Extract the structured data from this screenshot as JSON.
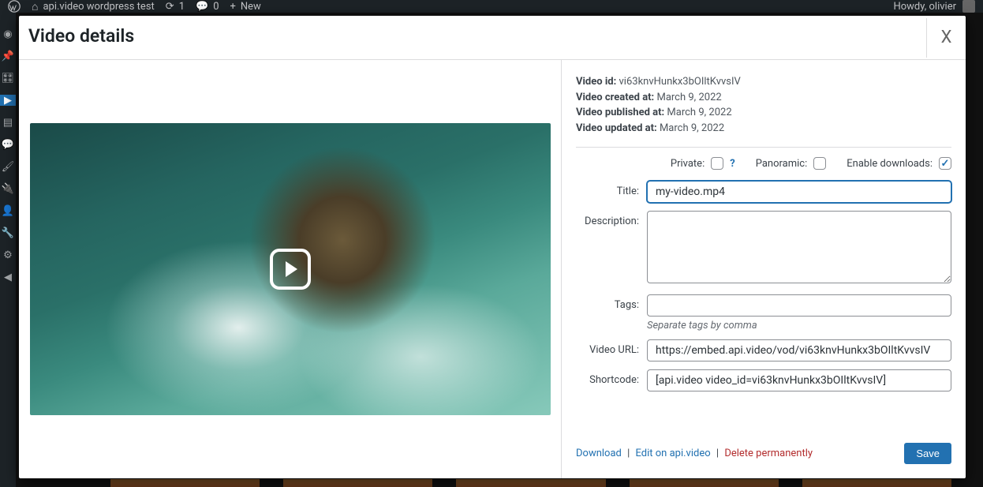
{
  "adminbar": {
    "site_title": "api.video wordpress test",
    "updates_count": "1",
    "comments_count": "0",
    "new_label": "New",
    "howdy": "Howdy, olivier"
  },
  "modal": {
    "title": "Video details",
    "close": "X"
  },
  "meta": {
    "video_id_label": "Video id:",
    "video_id": "vi63knvHunkx3bOIltKvvsIV",
    "created_label": "Video created at:",
    "created": "March 9, 2022",
    "published_label": "Video published at:",
    "published": "March 9, 2022",
    "updated_label": "Video updated at:",
    "updated": "March 9, 2022"
  },
  "checks": {
    "private_label": "Private:",
    "private_checked": false,
    "help": "?",
    "panoramic_label": "Panoramic:",
    "panoramic_checked": false,
    "downloads_label": "Enable downloads:",
    "downloads_checked": true
  },
  "form": {
    "title_label": "Title:",
    "title_value": "my-video.mp4",
    "description_label": "Description:",
    "description_value": "",
    "tags_label": "Tags:",
    "tags_value": "",
    "tags_hint": "Separate tags by comma",
    "video_url_label": "Video URL:",
    "video_url_value": "https://embed.api.video/vod/vi63knvHunkx3bOIltKvvsIV",
    "shortcode_label": "Shortcode:",
    "shortcode_value": "[api.video video_id=vi63knvHunkx3bOIltKvvsIV]"
  },
  "footer": {
    "download": "Download",
    "edit": "Edit on api.video",
    "delete": "Delete permanently",
    "sep": "|",
    "save": "Save"
  }
}
